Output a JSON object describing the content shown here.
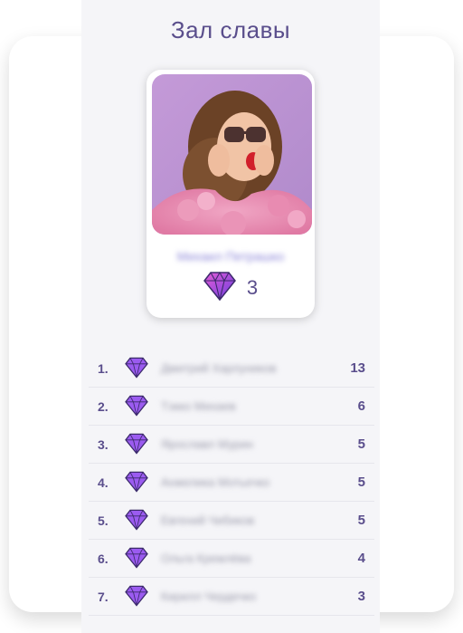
{
  "title": "Зал славы",
  "winner": {
    "name": "Михаил Петрашко",
    "score": "3",
    "photo_icon": "winner-photo"
  },
  "leaderboard": [
    {
      "rank": "1.",
      "name": "Дмитрий Харлуников",
      "score": "13"
    },
    {
      "rank": "2.",
      "name": "Тэккo Михаев",
      "score": "6"
    },
    {
      "rank": "3.",
      "name": "Ярославл Мурин",
      "score": "5"
    },
    {
      "rank": "4.",
      "name": "Анжелика Мотьечко",
      "score": "5"
    },
    {
      "rank": "5.",
      "name": "Евгений Чибиков",
      "score": "5"
    },
    {
      "rank": "6.",
      "name": "Ольга Кремлёва",
      "score": "4"
    },
    {
      "rank": "7.",
      "name": "Кирилл Чердечко",
      "score": "3"
    }
  ],
  "colors": {
    "accent": "#5a4e8c",
    "gem_purple": "#7b3fe4",
    "gem_pink": "#e55bd6"
  },
  "icons": {
    "gem": "diamond-icon"
  }
}
